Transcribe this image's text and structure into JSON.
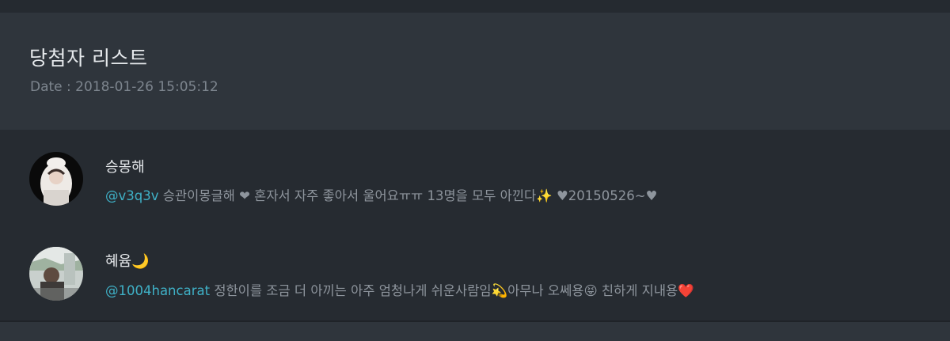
{
  "header": {
    "title": "당첨자 리스트",
    "date_label": "Date : 2018-01-26 15:05:12"
  },
  "entries": [
    {
      "name": "승몽해",
      "handle": "@v3q3v",
      "bio": " 승관이몽글해 ❤ 혼자서 자주 좋아서 울어요ㅠㅠ 13명을 모두 아낀다✨ ♥20150526~♥"
    },
    {
      "name": "혜윰🌙",
      "handle": "@1004hancarat",
      "bio": " 정한이를 조금 더 아끼는 아주 엄청나게 쉬운사람임💫아무나 오쎄용😝 친하게 지내용❤️"
    }
  ],
  "colors": {
    "background": "#262b31",
    "header_bg": "#2f353c",
    "handle": "#3fb1c7",
    "text_muted": "#8e959d"
  }
}
